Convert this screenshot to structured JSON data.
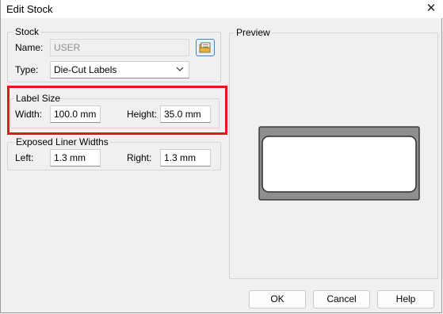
{
  "window": {
    "title": "Edit Stock"
  },
  "stock": {
    "group_label": "Stock",
    "name_label": "Name:",
    "name_value": "USER",
    "type_label": "Type:",
    "type_value": "Die-Cut Labels"
  },
  "label_size": {
    "group_label": "Label Size",
    "width_label": "Width:",
    "width_value": "100.0 mm",
    "height_label": "Height:",
    "height_value": "35.0 mm"
  },
  "liner": {
    "group_label": "Exposed Liner Widths",
    "left_label": "Left:",
    "left_value": "1.3 mm",
    "right_label": "Right:",
    "right_value": "1.3 mm"
  },
  "preview": {
    "group_label": "Preview"
  },
  "buttons": {
    "ok": "OK",
    "cancel": "Cancel",
    "help": "Help"
  },
  "colors": {
    "highlight": "#e1161f",
    "accent": "#3d86c6"
  },
  "icons": {
    "close": "close-icon",
    "browse": "folder-icon",
    "dropdown": "chevron-down-icon"
  }
}
